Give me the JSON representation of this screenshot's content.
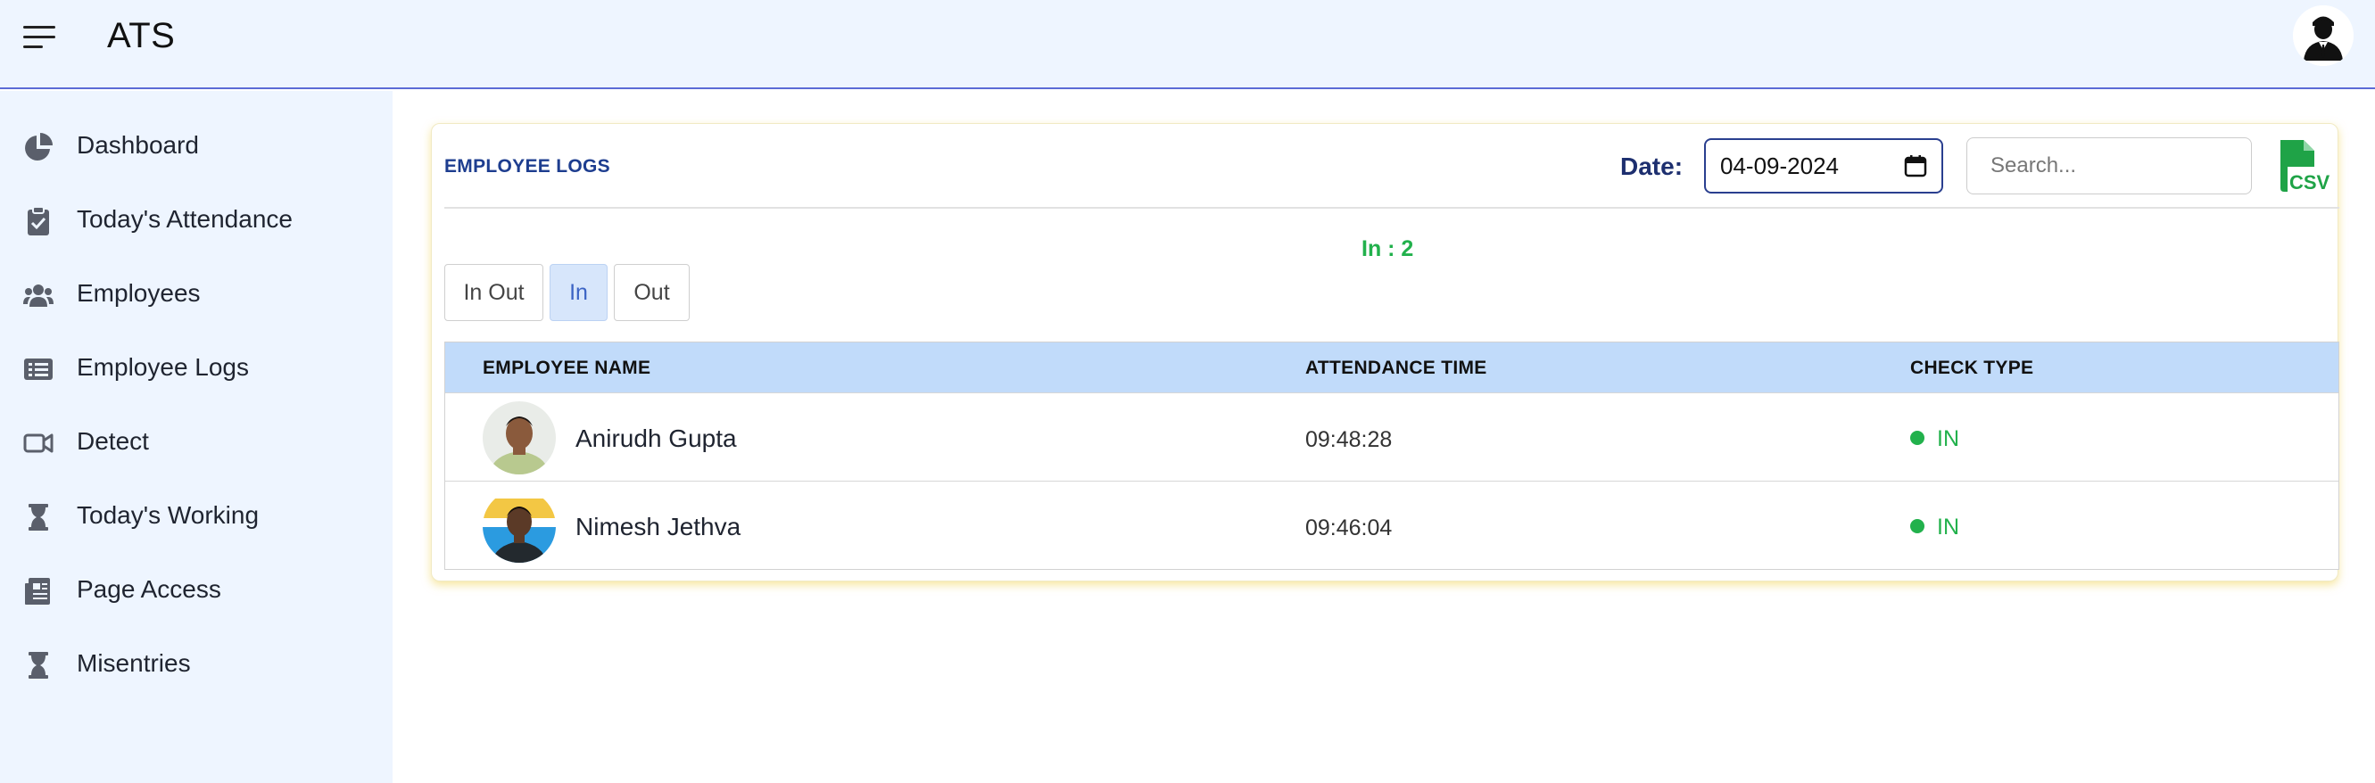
{
  "app": {
    "title": "ATS"
  },
  "header": {
    "menu_icon": "hamburger-icon",
    "avatar_icon": "user-avatar-icon"
  },
  "sidebar": {
    "items": [
      {
        "label": "Dashboard",
        "icon": "pie-chart-icon"
      },
      {
        "label": "Today's Attendance",
        "icon": "clipboard-check-icon"
      },
      {
        "label": "Employees",
        "icon": "users-icon"
      },
      {
        "label": "Employee Logs",
        "icon": "list-icon"
      },
      {
        "label": "Detect",
        "icon": "video-camera-icon"
      },
      {
        "label": "Today's Working",
        "icon": "hourglass-icon"
      },
      {
        "label": "Page Access",
        "icon": "document-icon"
      },
      {
        "label": "Misentries",
        "icon": "hourglass-icon"
      }
    ]
  },
  "card": {
    "title": "EMPLOYEE LOGS",
    "date_label": "Date:",
    "date_value": "04-09-2024",
    "search_placeholder": "Search...",
    "csv_label": "CSV",
    "count_text": "In : 2",
    "filters": [
      {
        "label": "In Out",
        "active": false
      },
      {
        "label": "In",
        "active": true
      },
      {
        "label": "Out",
        "active": false
      }
    ],
    "table": {
      "headers": [
        "EMPLOYEE NAME",
        "ATTENDANCE TIME",
        "CHECK TYPE"
      ],
      "rows": [
        {
          "name": "Anirudh Gupta",
          "time": "09:48:28",
          "check_type": "IN"
        },
        {
          "name": "Nimesh Jethva",
          "time": "09:46:04",
          "check_type": "IN"
        }
      ]
    }
  },
  "colors": {
    "accent": "#1d3d8f",
    "status_in": "#22b14c",
    "table_header": "#c1dbfa",
    "sidebar_bg": "#eef5ff"
  }
}
